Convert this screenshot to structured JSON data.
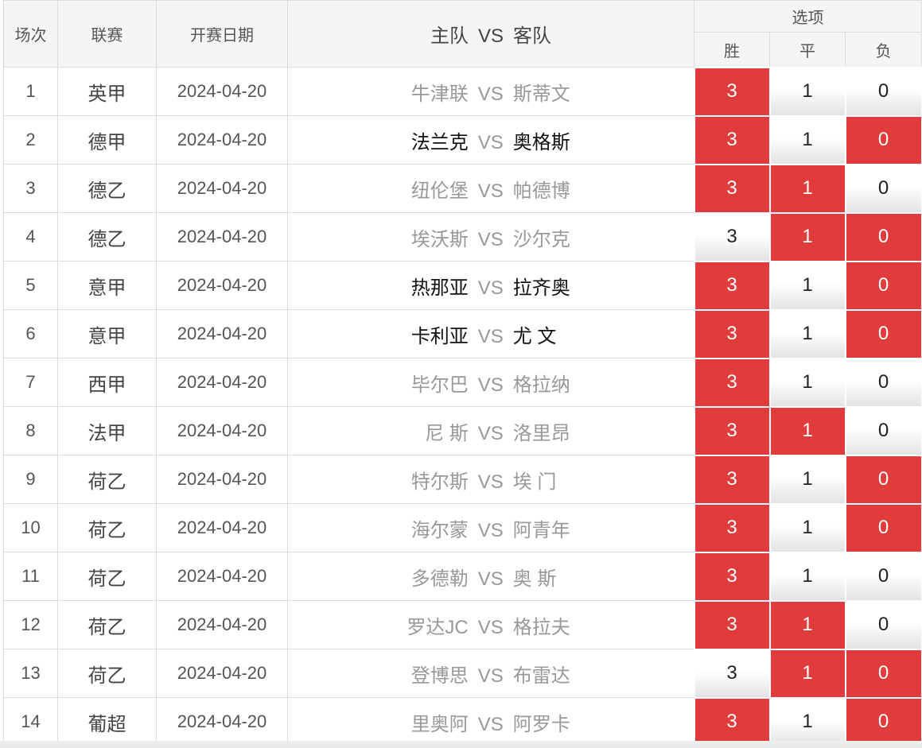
{
  "headers": {
    "no": "场次",
    "league": "联赛",
    "date": "开赛日期",
    "home": "主队",
    "vs": "VS",
    "away": "客队",
    "options": "选项",
    "win": "胜",
    "draw": "平",
    "lose": "负"
  },
  "option_values": {
    "win": "3",
    "draw": "1",
    "lose": "0"
  },
  "colors": {
    "selected": "#e03c3c",
    "header_bg": "#f5f5f5"
  },
  "matches": [
    {
      "no": "1",
      "league": "英甲",
      "date": "2024-04-20",
      "home": "牛津联",
      "away": "斯蒂文",
      "highlight": false,
      "selected": [
        "win"
      ]
    },
    {
      "no": "2",
      "league": "德甲",
      "date": "2024-04-20",
      "home": "法兰克",
      "away": "奥格斯",
      "highlight": true,
      "selected": [
        "win",
        "lose"
      ]
    },
    {
      "no": "3",
      "league": "德乙",
      "date": "2024-04-20",
      "home": "纽伦堡",
      "away": "帕德博",
      "highlight": false,
      "selected": [
        "win",
        "draw"
      ]
    },
    {
      "no": "4",
      "league": "德乙",
      "date": "2024-04-20",
      "home": "埃沃斯",
      "away": "沙尔克",
      "highlight": false,
      "selected": [
        "draw",
        "lose"
      ]
    },
    {
      "no": "5",
      "league": "意甲",
      "date": "2024-04-20",
      "home": "热那亚",
      "away": "拉齐奥",
      "highlight": true,
      "selected": [
        "win",
        "lose"
      ]
    },
    {
      "no": "6",
      "league": "意甲",
      "date": "2024-04-20",
      "home": "卡利亚",
      "away": "尤 文",
      "highlight": true,
      "selected": [
        "win",
        "lose"
      ]
    },
    {
      "no": "7",
      "league": "西甲",
      "date": "2024-04-20",
      "home": "毕尔巴",
      "away": "格拉纳",
      "highlight": false,
      "selected": [
        "win"
      ]
    },
    {
      "no": "8",
      "league": "法甲",
      "date": "2024-04-20",
      "home": "尼 斯",
      "away": "洛里昂",
      "highlight": false,
      "selected": [
        "win",
        "draw"
      ]
    },
    {
      "no": "9",
      "league": "荷乙",
      "date": "2024-04-20",
      "home": "特尔斯",
      "away": "埃 门",
      "highlight": false,
      "selected": [
        "win",
        "lose"
      ]
    },
    {
      "no": "10",
      "league": "荷乙",
      "date": "2024-04-20",
      "home": "海尔蒙",
      "away": "阿青年",
      "highlight": false,
      "selected": [
        "win",
        "lose"
      ]
    },
    {
      "no": "11",
      "league": "荷乙",
      "date": "2024-04-20",
      "home": "多德勒",
      "away": "奥 斯",
      "highlight": false,
      "selected": [
        "win"
      ]
    },
    {
      "no": "12",
      "league": "荷乙",
      "date": "2024-04-20",
      "home": "罗达JC",
      "away": "格拉夫",
      "highlight": false,
      "selected": [
        "win",
        "draw"
      ]
    },
    {
      "no": "13",
      "league": "荷乙",
      "date": "2024-04-20",
      "home": "登博思",
      "away": "布雷达",
      "highlight": false,
      "selected": [
        "draw",
        "lose"
      ]
    },
    {
      "no": "14",
      "league": "葡超",
      "date": "2024-04-20",
      "home": "里奥阿",
      "away": "阿罗卡",
      "highlight": false,
      "selected": [
        "win",
        "lose"
      ]
    }
  ]
}
